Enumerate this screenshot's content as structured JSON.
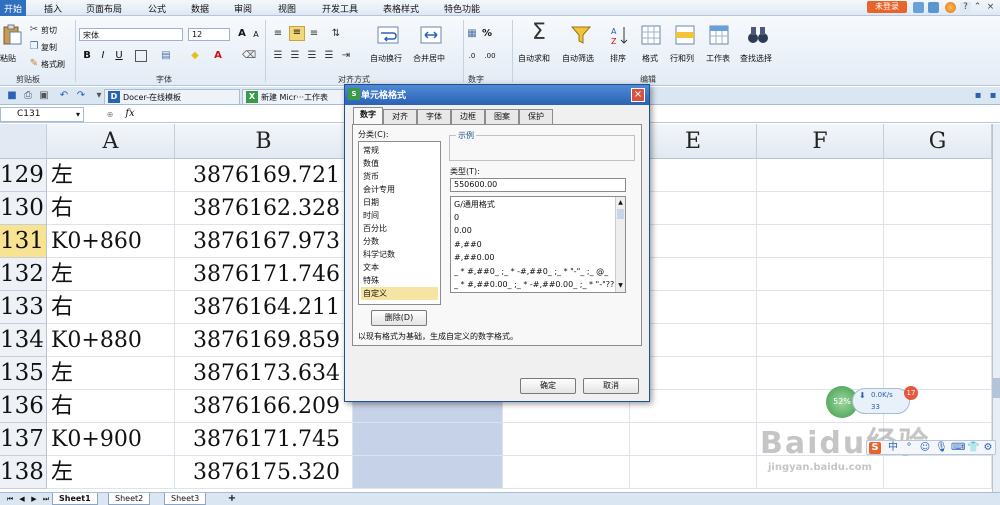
{
  "menubar": {
    "items": [
      "开始",
      "插入",
      "页面布局",
      "公式",
      "数据",
      "审阅",
      "视图",
      "开发工具",
      "表格样式",
      "特色功能"
    ],
    "login": "未登录"
  },
  "ribbon": {
    "clipboard": {
      "paste": "粘贴",
      "cut": "剪切",
      "copy": "复制",
      "format_painter": "格式刷",
      "group": "剪贴板"
    },
    "font": {
      "name": "宋体",
      "size": "12",
      "bold": "B",
      "italic": "I",
      "underline": "U",
      "font_color_letter": "A",
      "group": "字体"
    },
    "align": {
      "wrap": "自动换行",
      "merge": "合并居中",
      "group": "对齐方式"
    },
    "number": {
      "percent": "%",
      "group": "数字"
    },
    "edit": {
      "autosum": "自动求和",
      "autofilter": "自动筛选",
      "sort": "排序",
      "format": "格式",
      "rowcol": "行和列",
      "sheet": "工作表",
      "find": "查找选择",
      "group": "编辑"
    }
  },
  "tabs": {
    "docer": "Docer-在线模板",
    "workbook": "新建 Micr···工作表"
  },
  "formula_bar": {
    "name_box": "C131",
    "fx": "fx"
  },
  "grid": {
    "columns": [
      "A",
      "B",
      "E",
      "F",
      "G"
    ],
    "rows": [
      {
        "num": "129",
        "a": "左",
        "b": "3876169.721"
      },
      {
        "num": "130",
        "a": "右",
        "b": "3876162.328"
      },
      {
        "num": "131",
        "a": "K0+860",
        "b": "3876167.973"
      },
      {
        "num": "132",
        "a": "左",
        "b": "3876171.746"
      },
      {
        "num": "133",
        "a": "右",
        "b": "3876164.211"
      },
      {
        "num": "134",
        "a": "K0+880",
        "b": "3876169.859"
      },
      {
        "num": "135",
        "a": "左",
        "b": "3876173.634"
      },
      {
        "num": "136",
        "a": "右",
        "b": "3876166.209"
      },
      {
        "num": "137",
        "a": "K0+900",
        "b": "3876171.745"
      },
      {
        "num": "138",
        "a": "左",
        "b": "3876175.320"
      }
    ]
  },
  "sheets": [
    "Sheet1",
    "Sheet2",
    "Sheet3"
  ],
  "dialog": {
    "title": "单元格格式",
    "tabs": [
      "数字",
      "对齐",
      "字体",
      "边框",
      "图案",
      "保护"
    ],
    "category_label": "分类(C):",
    "categories": [
      "常规",
      "数值",
      "货币",
      "会计专用",
      "日期",
      "时间",
      "百分比",
      "分数",
      "科学记数",
      "文本",
      "特殊",
      "自定义"
    ],
    "sample_label": "示例",
    "type_label": "类型(T):",
    "type_value": "550600.00",
    "formats": [
      "G/通用格式",
      "0",
      "0.00",
      "#,##0",
      "#,##0.00",
      "_ * #,##0_ ;_ * -#,##0_ ;_ * \"-\"_ ;_ @_",
      "_ * #,##0.00_ ;_ * -#,##0.00_ ;_ * \"-\"??_ ;_ @_"
    ],
    "delete_button": "删除(D)",
    "description": "以现有格式为基础，生成自定义的数字格式。",
    "ok_button": "确定",
    "cancel_button": "取消"
  },
  "widget": {
    "percent": "52%",
    "speed": "0.0K/s",
    "count": "17",
    "sub": "33"
  },
  "watermark": {
    "brand": "Baidu经验",
    "url": "jingyan.baidu.com"
  }
}
